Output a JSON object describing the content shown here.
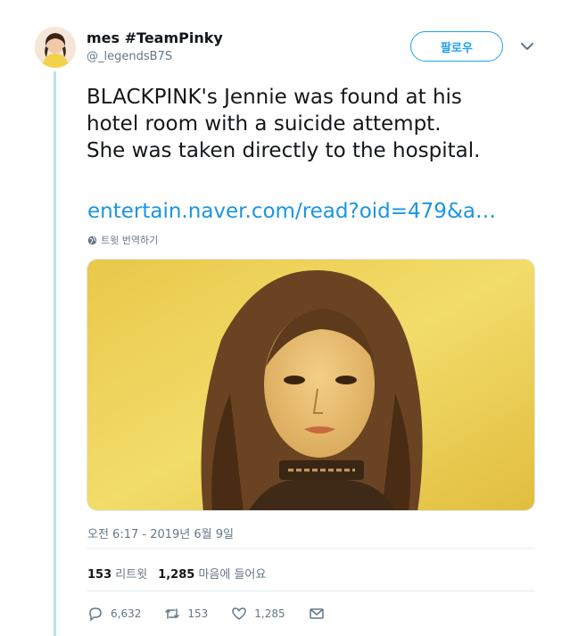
{
  "user": {
    "display_name": "mes #TeamPinky",
    "handle": "@_legendsB7S"
  },
  "follow_label": "팔로우",
  "tweet": {
    "text": "BLACKPINK's Jennie was found at his\nhotel room with a suicide attempt.\nShe was taken directly to the hospital.",
    "link": "entertain.naver.com/read?oid=479&a…",
    "translate_label": "트윗 번역하기",
    "timestamp": "오전 6:17 - 2019년 6월 9일"
  },
  "stats": {
    "retweets_count": "153",
    "retweets_label": "리트윗",
    "likes_count": "1,285",
    "likes_label": "마음에 들어요"
  },
  "actions": {
    "replies": "6,632",
    "retweets": "153",
    "likes": "1,285"
  },
  "colors": {
    "accent": "#1da1f2",
    "link": "#1b95e0",
    "thread_line": "#b8e0f5",
    "muted": "#657786"
  }
}
